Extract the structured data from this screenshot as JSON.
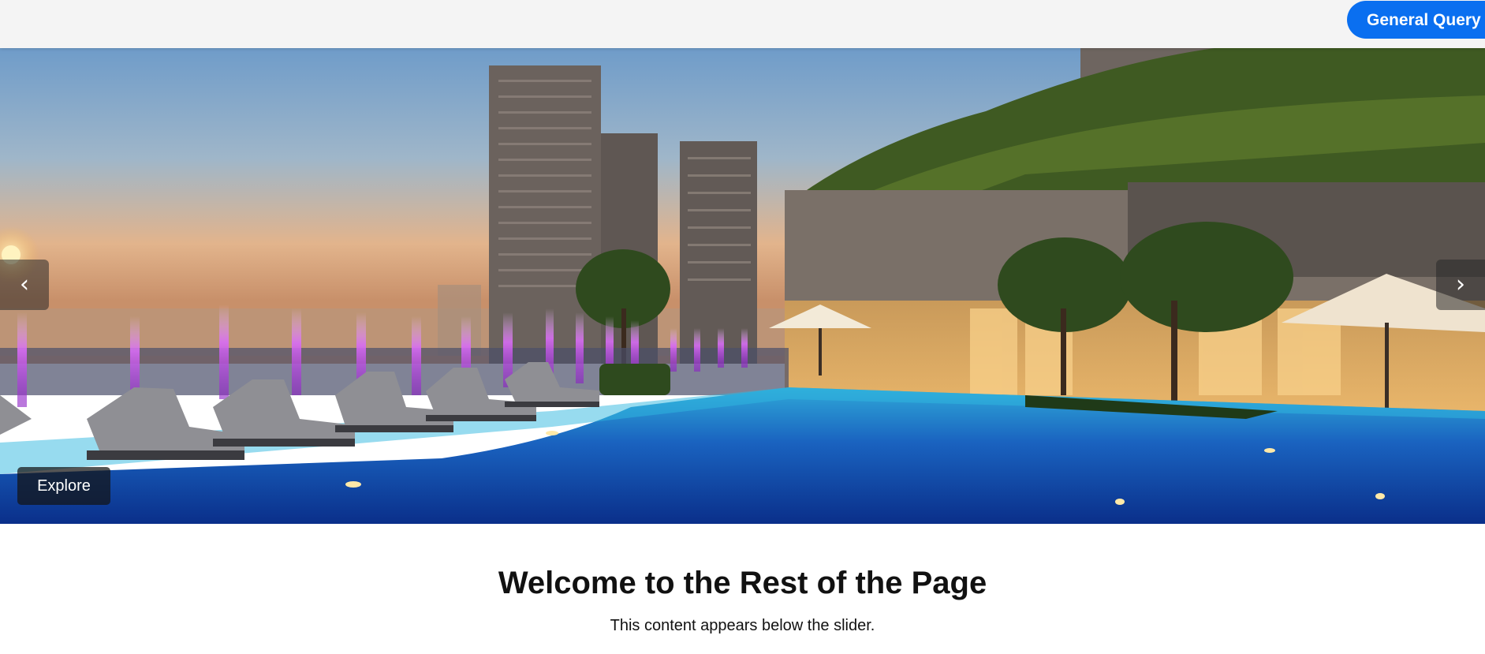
{
  "header": {
    "query_button_label": "General Query"
  },
  "slider": {
    "prev_label": "‹",
    "next_label": "›",
    "explore_label": "Explore",
    "slide_image": "rooftop-pool-residential-towers-photo"
  },
  "content": {
    "heading": "Welcome to the Rest of the Page",
    "text": "This content appears below the slider."
  },
  "colors": {
    "accent": "#0a6ff0",
    "header_bg": "#f4f4f4"
  }
}
